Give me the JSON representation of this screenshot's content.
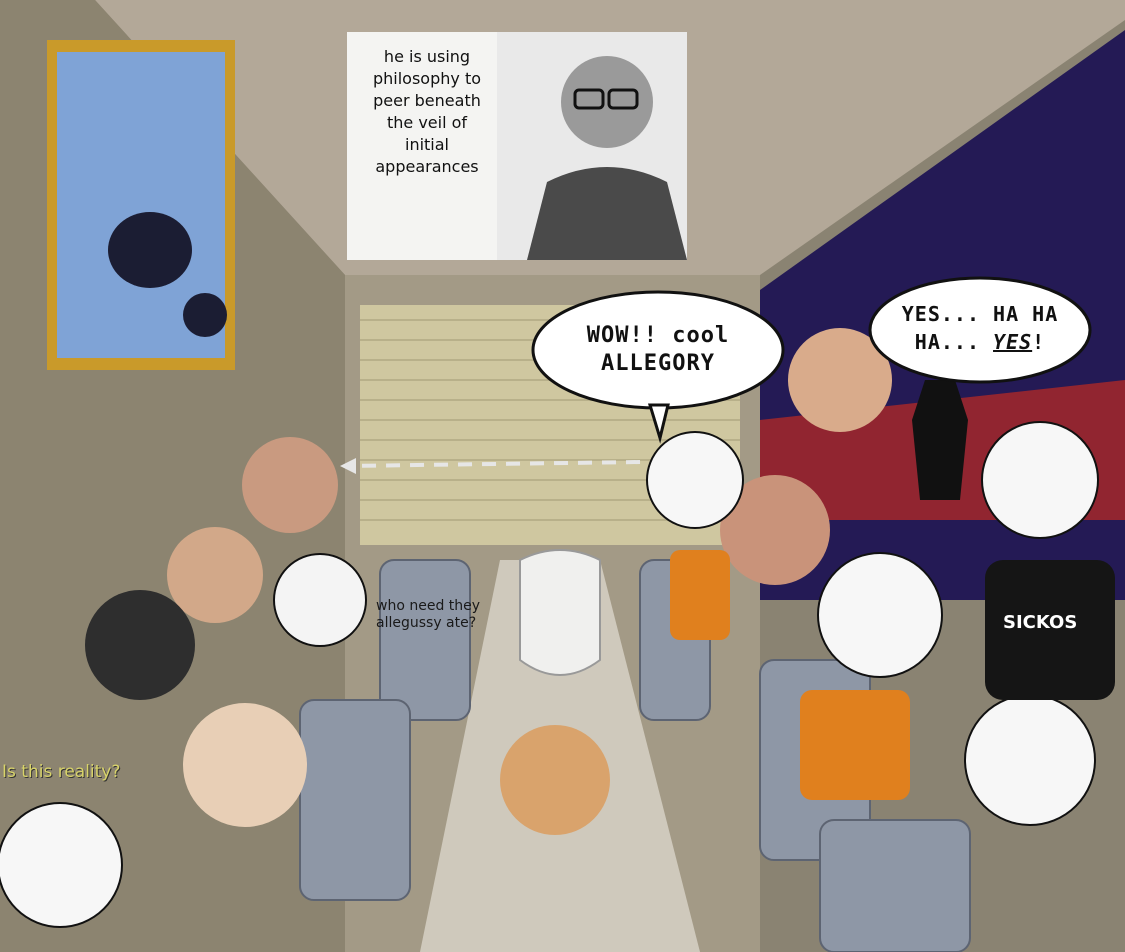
{
  "caption": {
    "lines": [
      "he is using",
      "philosophy to",
      "peer beneath",
      "the veil of",
      "initial",
      "appearances"
    ]
  },
  "bubble_left": {
    "line1": "WOW!! cool",
    "line2": "ALLEGORY"
  },
  "bubble_right": {
    "line1": "YES... HA HA",
    "line2_a": "HA... ",
    "line2_b": "YES",
    "line2_c": "!"
  },
  "shirt_label": "SICKOS",
  "mid_text": {
    "line1": "who need they",
    "line2": "allegussy ate?"
  },
  "corner_text": "Is this reality?",
  "colors": {
    "wall": "#8c8470",
    "ceiling": "#b3a898",
    "blinds": "#cfc7a0",
    "seat": "#8e97a6",
    "night_sky": "#241a55",
    "caption_text": "#111111",
    "corner_text": "#d8d36a"
  }
}
